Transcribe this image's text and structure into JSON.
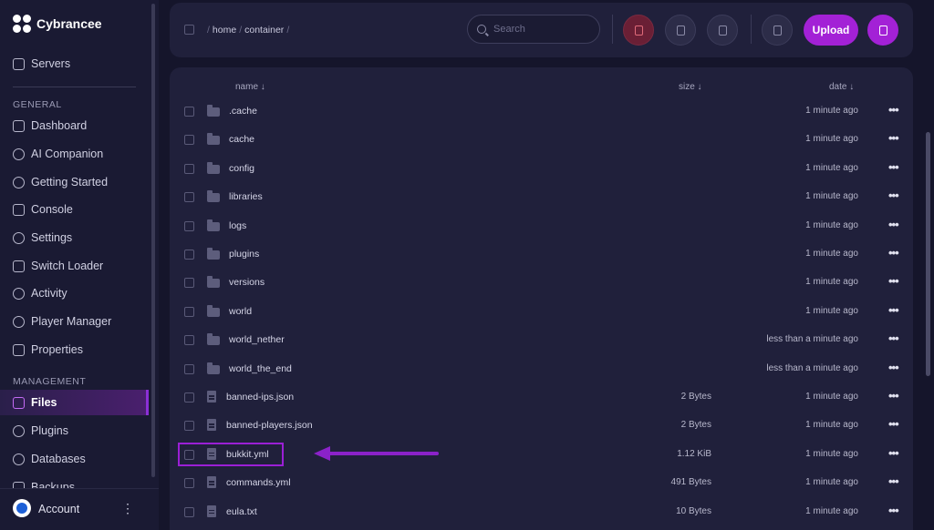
{
  "brand": {
    "name": "Cybrancee"
  },
  "sidebar": {
    "top_item": "Servers",
    "general_heading": "GENERAL",
    "general_items": [
      "Dashboard",
      "AI Companion",
      "Getting Started",
      "Console",
      "Settings",
      "Switch Loader",
      "Activity",
      "Player Manager",
      "Properties"
    ],
    "management_heading": "MANAGEMENT",
    "management_items": [
      "Files",
      "Plugins",
      "Databases",
      "Backups"
    ],
    "active_item": "Files",
    "account_label": "Account",
    "account_menu_glyph": "⋮"
  },
  "toolbar": {
    "breadcrumb": [
      "home",
      "container"
    ],
    "search_placeholder": "Search",
    "upload_label": "Upload",
    "icons": [
      "trash-icon",
      "move-folder-icon",
      "archive-icon",
      "new-folder-icon",
      "new-file-icon"
    ],
    "accent_color": "#a321d6",
    "danger_color": "#6a1f35"
  },
  "table": {
    "col_name": "name ↓",
    "col_size": "size ↓",
    "col_date": "date ↓",
    "rows": [
      {
        "name": ".cache",
        "type": "folder",
        "size": "",
        "date": "1 minute ago"
      },
      {
        "name": "cache",
        "type": "folder",
        "size": "",
        "date": "1 minute ago"
      },
      {
        "name": "config",
        "type": "folder",
        "size": "",
        "date": "1 minute ago"
      },
      {
        "name": "libraries",
        "type": "folder",
        "size": "",
        "date": "1 minute ago"
      },
      {
        "name": "logs",
        "type": "folder",
        "size": "",
        "date": "1 minute ago"
      },
      {
        "name": "plugins",
        "type": "folder",
        "size": "",
        "date": "1 minute ago"
      },
      {
        "name": "versions",
        "type": "folder",
        "size": "",
        "date": "1 minute ago"
      },
      {
        "name": "world",
        "type": "folder",
        "size": "",
        "date": "1 minute ago"
      },
      {
        "name": "world_nether",
        "type": "folder",
        "size": "",
        "date": "less than a minute ago"
      },
      {
        "name": "world_the_end",
        "type": "folder",
        "size": "",
        "date": "less than a minute ago"
      },
      {
        "name": "banned-ips.json",
        "type": "file",
        "size": "2 Bytes",
        "date": "1 minute ago"
      },
      {
        "name": "banned-players.json",
        "type": "file",
        "size": "2 Bytes",
        "date": "1 minute ago"
      },
      {
        "name": "bukkit.yml",
        "type": "file",
        "size": "1.12 KiB",
        "date": "1 minute ago"
      },
      {
        "name": "commands.yml",
        "type": "file",
        "size": "491 Bytes",
        "date": "1 minute ago"
      },
      {
        "name": "eula.txt",
        "type": "file",
        "size": "10 Bytes",
        "date": "1 minute ago"
      }
    ],
    "row_menu_glyph": "•••"
  },
  "annotation": {
    "highlighted_file": "bukkit.yml",
    "color": "#9b1fd6"
  }
}
